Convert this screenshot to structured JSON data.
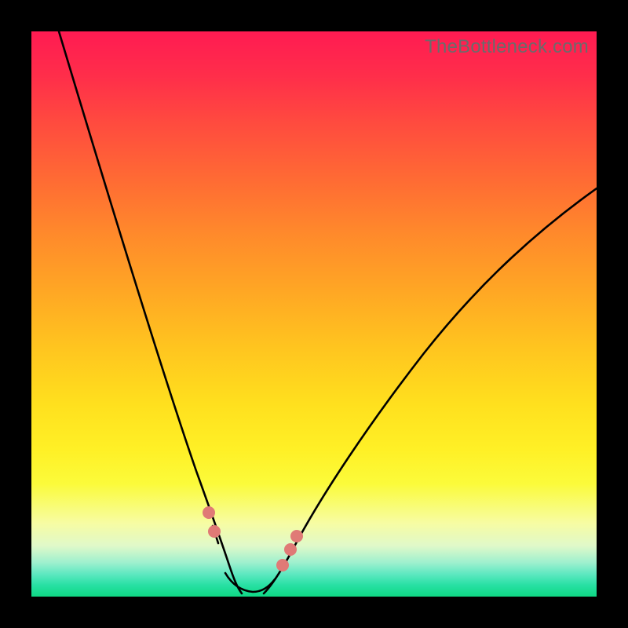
{
  "watermark": "TheBottleneck.com",
  "colors": {
    "frame": "#000000",
    "marker": "#e07a76",
    "curve": "#000000",
    "gradient_top": "#ff1b52",
    "gradient_bottom": "#0fd884"
  },
  "chart_data": {
    "type": "line",
    "title": "",
    "xlabel": "",
    "ylabel": "",
    "xlim": [
      0,
      100
    ],
    "ylim": [
      0,
      100
    ],
    "x": [
      0,
      5,
      10,
      15,
      18,
      20,
      22,
      24,
      26,
      28,
      30,
      31,
      32,
      33,
      34,
      35,
      36,
      37,
      38,
      39,
      40,
      42,
      44,
      46,
      48,
      50,
      55,
      60,
      65,
      70,
      75,
      80,
      85,
      90,
      95,
      100
    ],
    "values": [
      100,
      88,
      77,
      65,
      58,
      53,
      48,
      42,
      36,
      29,
      22,
      18,
      14,
      10,
      6,
      3,
      1,
      0,
      0,
      0,
      1,
      2,
      5,
      9,
      13,
      17,
      26,
      34,
      40,
      46,
      51,
      55,
      58,
      61,
      63,
      65
    ],
    "background_meaning": "vertical gradient red→yellow→green encodes good (bottom/green) to bad (top/red)",
    "minimum_region_x": [
      33,
      42
    ],
    "markers": [
      {
        "x": 30,
        "y": 22,
        "kind": "dot"
      },
      {
        "x": 31,
        "y": 18,
        "kind": "dot"
      },
      {
        "x": 33,
        "y": 8,
        "kind": "segment_start"
      },
      {
        "x": 42,
        "y": 3,
        "kind": "segment_end"
      },
      {
        "x": 44,
        "y": 6,
        "kind": "dot"
      },
      {
        "x": 46,
        "y": 10,
        "kind": "dot"
      },
      {
        "x": 47,
        "y": 13,
        "kind": "dot"
      }
    ]
  }
}
